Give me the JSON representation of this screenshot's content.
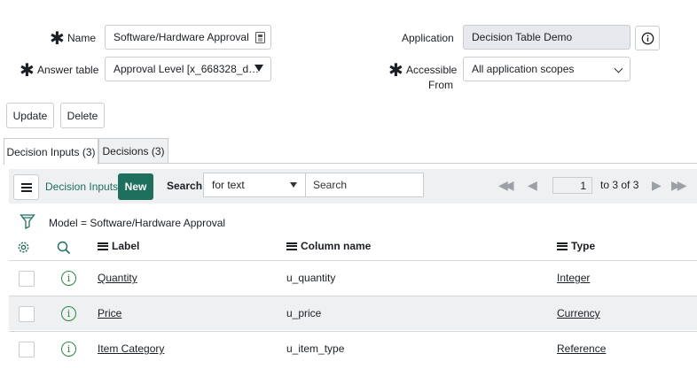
{
  "form": {
    "name_label": "Name",
    "name_value": "Software/Hardware Approval",
    "answer_table_label": "Answer table",
    "answer_table_value": "Approval Level  [x_668328_d…",
    "application_label": "Application",
    "application_value": "Decision Table Demo",
    "accessible_label_line1": "Accessible",
    "accessible_label_line2": "From",
    "accessible_value": "All application scopes"
  },
  "actions": {
    "update_label": "Update",
    "delete_label": "Delete"
  },
  "tabs": [
    {
      "label": "Decision Inputs (3)",
      "active": true
    },
    {
      "label": "Decisions (3)",
      "active": false
    }
  ],
  "list": {
    "title": "Decision Inputs",
    "new_label": "New",
    "search_label": "Search",
    "search_field": "for text",
    "search_placeholder": "Search",
    "page_value": "1",
    "range_text": "to 3 of 3",
    "filter_text": "Model = Software/Hardware Approval",
    "columns": [
      "Label",
      "Column name",
      "Type"
    ],
    "rows": [
      {
        "label": "Quantity",
        "column_name": "u_quantity",
        "type": "Integer"
      },
      {
        "label": "Price",
        "column_name": "u_price",
        "type": "Currency"
      },
      {
        "label": "Item Category",
        "column_name": "u_item_type",
        "type": "Reference"
      }
    ]
  },
  "colors": {
    "accent": "#1f6f5f",
    "info": "#2e8540",
    "readonly_bg": "#e7e9ec"
  }
}
